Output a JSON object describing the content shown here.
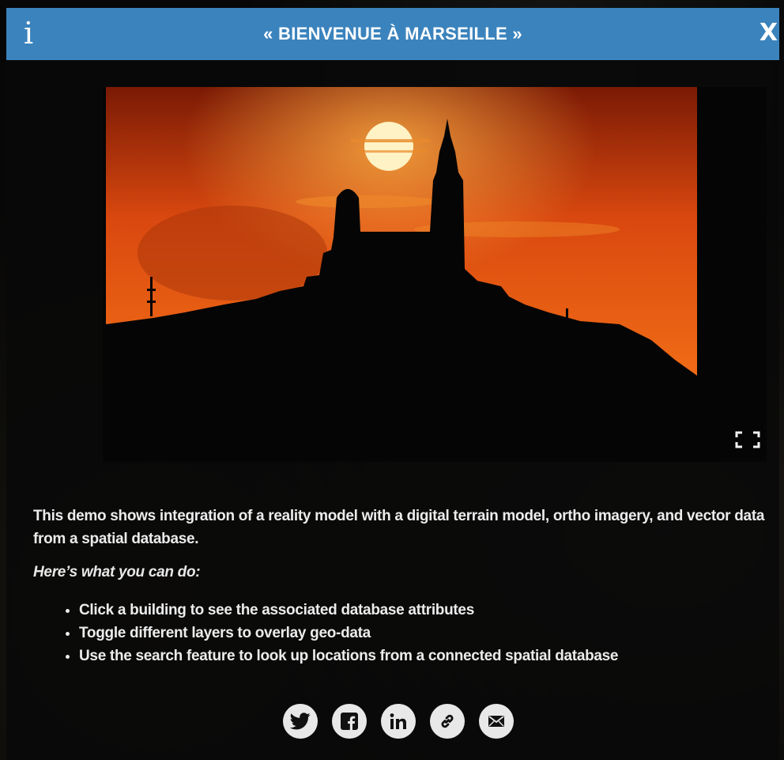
{
  "dialog": {
    "title": "« BIENVENUE À MARSEILLE »",
    "info_label": "i",
    "close_label": "X"
  },
  "content": {
    "description": "This demo shows integration of a reality model with a digital terrain model, ortho imagery, and vector data from a spatial database.",
    "prompt": "Here’s what you can do:",
    "actions": [
      "Click a building to see the associated database attributes",
      "Toggle different layers to overlay geo-data",
      "Use the search feature to look up locations from a connected spatial database"
    ]
  },
  "share": [
    {
      "icon": "twitter-icon"
    },
    {
      "icon": "facebook-icon"
    },
    {
      "icon": "linkedin-icon"
    },
    {
      "icon": "link-icon"
    },
    {
      "icon": "email-icon"
    }
  ],
  "colors": {
    "titlebar": "#3b83bd",
    "sky": "#d9480f",
    "sun": "#fff2c4"
  }
}
